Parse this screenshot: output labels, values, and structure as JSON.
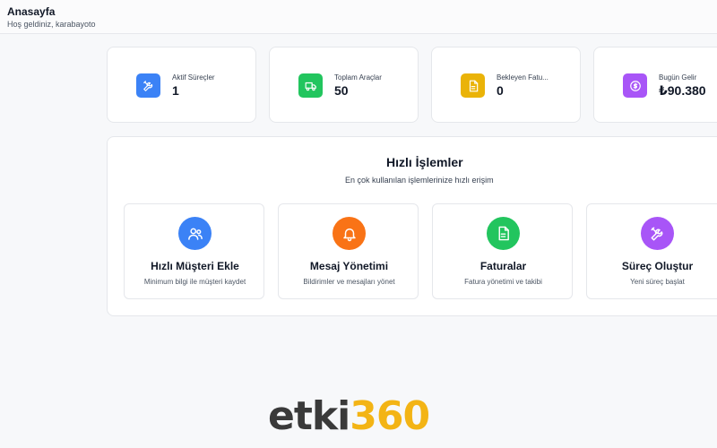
{
  "header": {
    "title": "Anasayfa",
    "subtitle": "Hoş geldiniz, karabayoto"
  },
  "stats": [
    {
      "label": "Aktif Süreçler",
      "value": "1",
      "icon": "tools-icon",
      "color": "#3b82f6"
    },
    {
      "label": "Toplam Araçlar",
      "value": "50",
      "icon": "truck-icon",
      "color": "#22c55e"
    },
    {
      "label": "Bekleyen Fatu...",
      "value": "0",
      "icon": "document-icon",
      "color": "#eab308"
    },
    {
      "label": "Bugün Gelir",
      "value": "₺90.380",
      "icon": "dollar-icon",
      "color": "#a855f7"
    }
  ],
  "quick_actions": {
    "title": "Hızlı İşlemler",
    "subtitle": "En çok kullanılan işlemlerinize hızlı erişim",
    "items": [
      {
        "title": "Hızlı Müşteri Ekle",
        "desc": "Minimum bilgi ile müşteri kaydet",
        "icon": "users-icon",
        "color": "#3b82f6"
      },
      {
        "title": "Mesaj Yönetimi",
        "desc": "Bildirimler ve mesajları yönet",
        "icon": "bell-icon",
        "color": "#f97316"
      },
      {
        "title": "Faturalar",
        "desc": "Fatura yönetimi ve takibi",
        "icon": "document-icon",
        "color": "#22c55e"
      },
      {
        "title": "Süreç Oluştur",
        "desc": "Yeni süreç başlat",
        "icon": "tools-icon",
        "color": "#a855f7"
      }
    ]
  },
  "logo": {
    "part1": "etki",
    "part2": "360"
  }
}
